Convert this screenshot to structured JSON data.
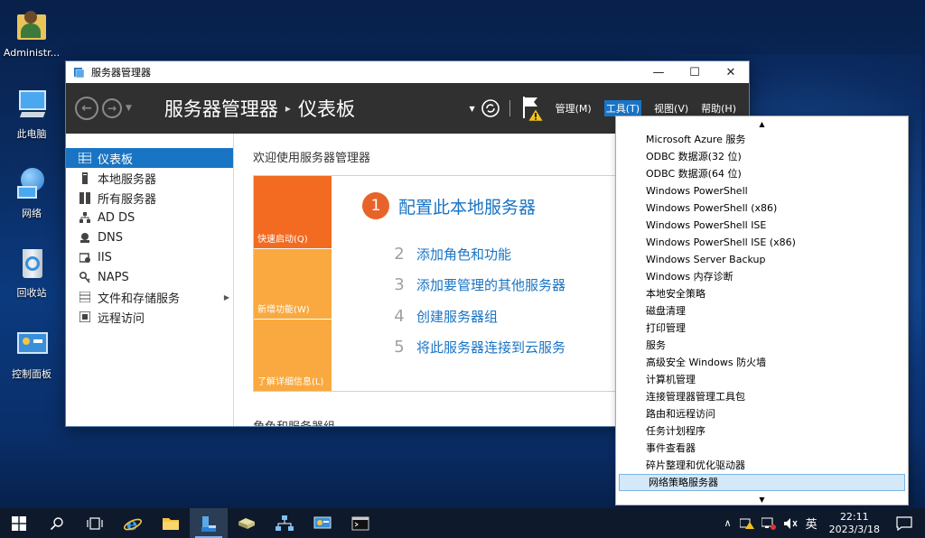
{
  "desktop": {
    "icons": [
      {
        "label": "Administr..."
      },
      {
        "label": "此电脑"
      },
      {
        "label": "网络"
      },
      {
        "label": "回收站"
      },
      {
        "label": "控制面板"
      }
    ]
  },
  "window": {
    "title": "服务器管理器",
    "controls": {
      "minimize": "—",
      "maximize": "☐",
      "close": "✕"
    }
  },
  "header": {
    "breadcrumb_root": "服务器管理器",
    "breadcrumb_separator": "▸",
    "breadcrumb_current": "仪表板",
    "menus": {
      "manage": "管理(M)",
      "tools": "工具(T)",
      "view": "视图(V)",
      "help": "帮助(H)"
    }
  },
  "sidebar": {
    "items": [
      {
        "label": "仪表板",
        "icon": "dashboard-icon"
      },
      {
        "label": "本地服务器",
        "icon": "server-icon"
      },
      {
        "label": "所有服务器",
        "icon": "servers-icon"
      },
      {
        "label": "AD DS",
        "icon": "adds-icon"
      },
      {
        "label": "DNS",
        "icon": "dns-icon"
      },
      {
        "label": "IIS",
        "icon": "iis-icon"
      },
      {
        "label": "NAPS",
        "icon": "naps-icon"
      },
      {
        "label": "文件和存储服务",
        "icon": "storage-icon"
      },
      {
        "label": "远程访问",
        "icon": "remote-icon"
      }
    ]
  },
  "content": {
    "welcome_title": "欢迎使用服务器管理器",
    "tiles": [
      {
        "label": "快速启动(Q)",
        "color": "#f26b21"
      },
      {
        "label": "新增功能(W)",
        "color": "#f9a93f"
      },
      {
        "label": "了解详细信息(L)",
        "color": "#f9a93f"
      }
    ],
    "steps": [
      {
        "num": "1",
        "text": "配置此本地服务器"
      },
      {
        "num": "2",
        "text": "添加角色和功能"
      },
      {
        "num": "3",
        "text": "添加要管理的其他服务器"
      },
      {
        "num": "4",
        "text": "创建服务器组"
      },
      {
        "num": "5",
        "text": "将此服务器连接到云服务"
      }
    ],
    "roles_title": "角色和服务器组"
  },
  "tools_menu": {
    "scroll_up": "▲",
    "scroll_down": "▼",
    "items": [
      "Microsoft Azure 服务",
      "ODBC 数据源(32 位)",
      "ODBC 数据源(64 位)",
      "Windows PowerShell",
      "Windows PowerShell (x86)",
      "Windows PowerShell ISE",
      "Windows PowerShell ISE (x86)",
      "Windows Server Backup",
      "Windows 内存诊断",
      "本地安全策略",
      "磁盘清理",
      "打印管理",
      "服务",
      "高级安全 Windows 防火墙",
      "计算机管理",
      "连接管理器管理工具包",
      "路由和远程访问",
      "任务计划程序",
      "事件查看器",
      "碎片整理和优化驱动器",
      "网络策略服务器"
    ],
    "hovered_item": "网络策略服务器"
  },
  "taskbar": {
    "ime": "英",
    "time": "22:11",
    "date": "2023/3/18"
  },
  "colors": {
    "accent": "#1a74c4",
    "header_bg": "#303030",
    "quick_start": "#f26b21",
    "tile_light": "#f9a93f"
  }
}
